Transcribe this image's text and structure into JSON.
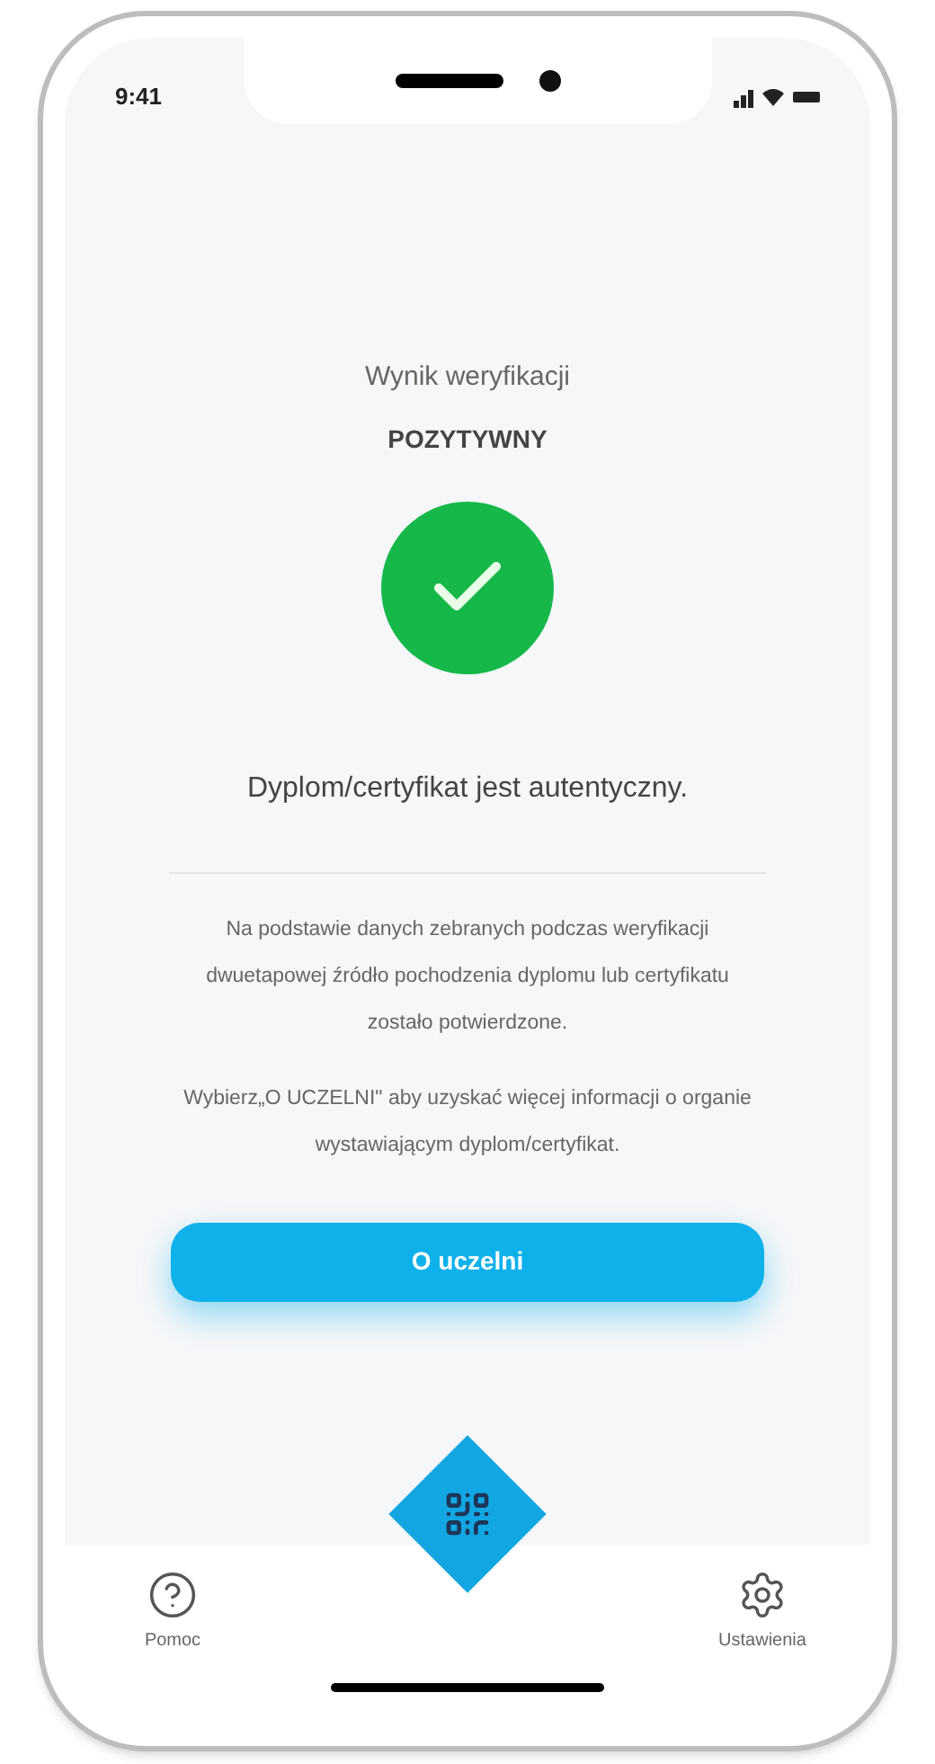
{
  "status_bar": {
    "time": "9:41"
  },
  "result": {
    "title": "Wynik weryfikacji",
    "status": "POZYTYWNY",
    "positive": true
  },
  "message": "Dyplom/certyfikat jest autentyczny.",
  "paragraphs": [
    "Na podstawie danych zebranych podczas weryfikacji dwuetapowej źródło pochodzenia dyplomu lub certyfikatu zostało potwierdzone.",
    "Wybierz„O UCZELNI\" aby uzyskać więcej informacji o organie wystawiającym dyplom/certyfikat."
  ],
  "button": {
    "label": "O uczelni"
  },
  "nav": [
    {
      "kind": "help",
      "label": "Pomoc"
    },
    {
      "kind": "scan"
    },
    {
      "kind": "settings",
      "label": "Ustawienia"
    }
  ]
}
